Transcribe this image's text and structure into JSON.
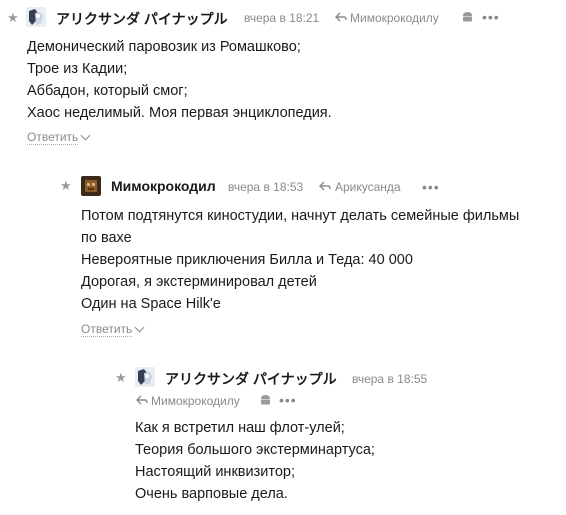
{
  "comments": [
    {
      "author": "アリクサンダ パイナップル",
      "time": "вчера в 18:21",
      "reply_to": "Мимокрокодилу",
      "lines": [
        "Демонический паровозик из Ромашково;",
        "Трое из Кадии;",
        "Аббадон, который смог;",
        "Хаос неделимый. Моя первая энциклопедия."
      ],
      "reply_label": "Ответить"
    },
    {
      "author": "Мимокрокодил",
      "time": "вчера в 18:53",
      "reply_to": "Арикусанда",
      "lines": [
        "Потом подтянутся киностудии, начнут делать семейные фильмы",
        "по вахе",
        "Невероятные приключения Билла и Теда: 40 000",
        "Дорогая, я экстерминировал детей",
        "Один на Space Hilk'e"
      ],
      "reply_label": "Ответить"
    },
    {
      "author": "アリクサンダ パイナップル",
      "time": "вчера в 18:55",
      "reply_to": "Мимокрокодилу",
      "lines": [
        "Как я встретил наш флот-улей;",
        "Теория большого экстерминартуса;",
        "Настоящий инквизитор;",
        "Очень варповые дела."
      ]
    }
  ],
  "icons": {
    "star": "star-icon",
    "reply": "reply-arrow-icon",
    "device": "android-icon",
    "more": "more-dots-icon"
  },
  "colors": {
    "text": "#1a1a1a",
    "meta": "#8a8a8a",
    "icon": "#9a9a9a"
  }
}
